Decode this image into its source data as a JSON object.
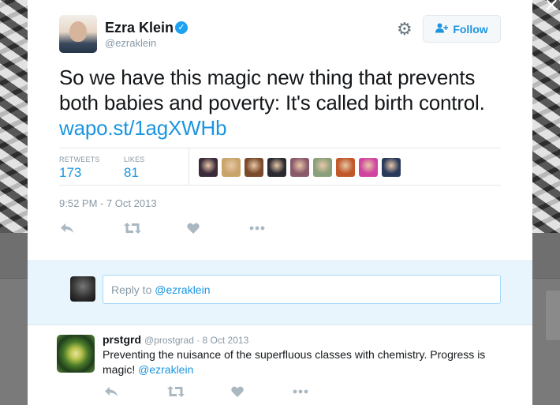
{
  "tweet": {
    "author_name": "Ezra Klein",
    "handle": "@ezraklein",
    "follow_label": "Follow",
    "text": "So we have this magic new thing that prevents both babies and poverty: It's called birth control. ",
    "link": "wapo.st/1agXWHb",
    "retweets_label": "RETWEETS",
    "retweets_count": "173",
    "likes_label": "LIKES",
    "likes_count": "81",
    "timestamp": "9:52 PM - 7 Oct 2013",
    "liker_colors": [
      "#3a2a3a",
      "#c9a46a",
      "#7a4a2a",
      "#2a2a30",
      "#8a5a6a",
      "#8aa07a",
      "#c0582a",
      "#d044a0",
      "#2a3a5a"
    ]
  },
  "reply_box": {
    "placeholder_prefix": "Reply to ",
    "mention": "@ezraklein"
  },
  "reply": {
    "author_name": "prstgrd",
    "meta": "@prostgrad · 8 Oct 2013",
    "text": "Preventing the nuisance of the superfluous classes with chemistry. Progress is magic! ",
    "mention": "@ezraklein"
  },
  "colors": {
    "accent": "#1b95e0",
    "muted": "#8899a6",
    "reply_bg": "#e8f5fd"
  }
}
